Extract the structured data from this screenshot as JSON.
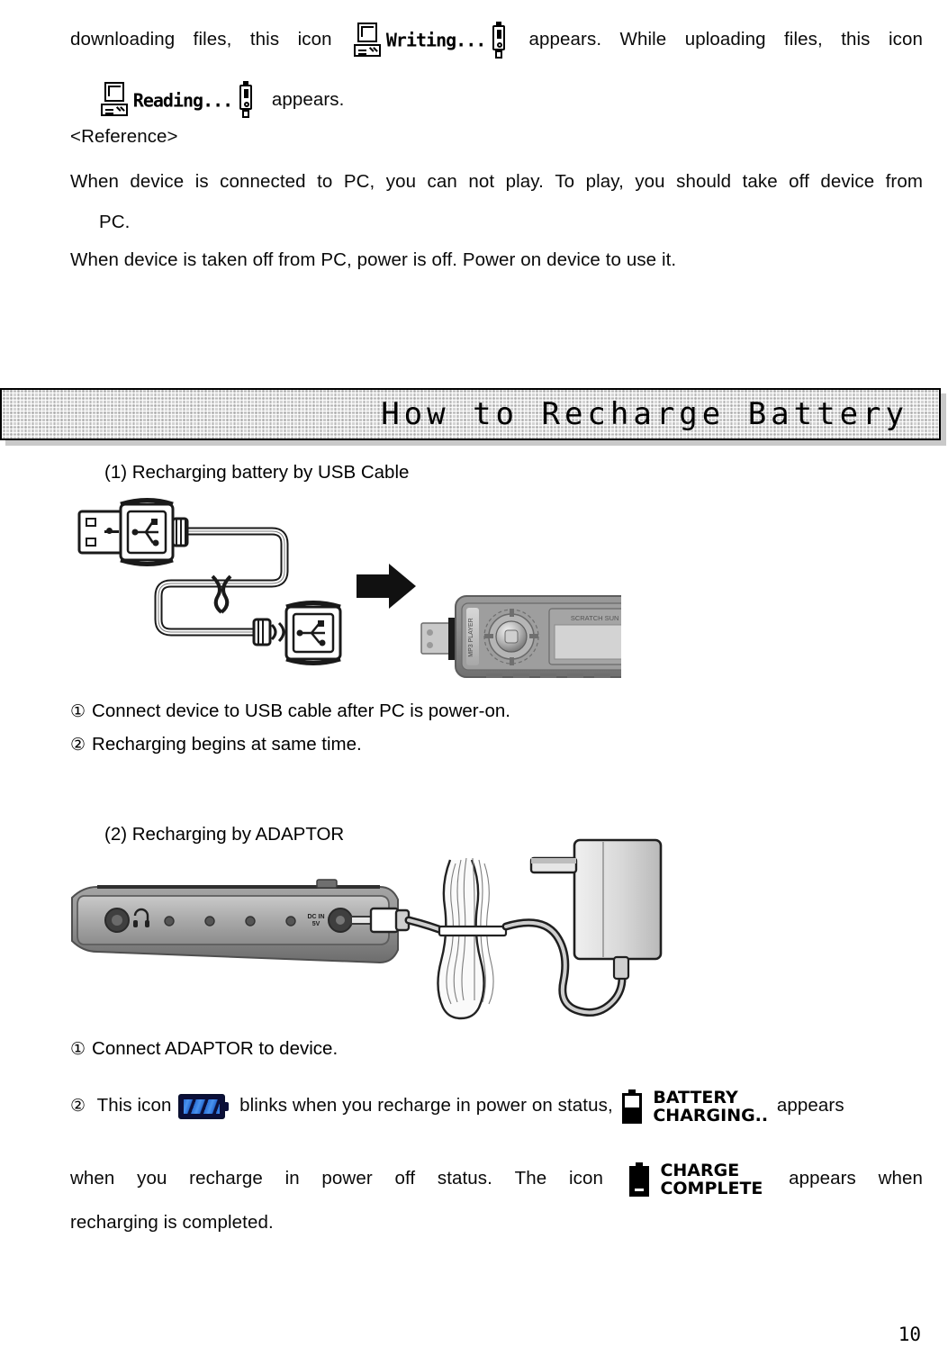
{
  "intro": {
    "line1_words": [
      "downloading",
      "files,",
      "this",
      "icon"
    ],
    "icon_writing_label": "Writing...",
    "line1_after": [
      "appears.",
      "While",
      "uploading",
      "files,",
      "this",
      "icon"
    ],
    "icon_reading_label": "Reading...",
    "line2_after": "appears."
  },
  "reference": {
    "heading": "<Reference>",
    "line1": "When device is connected to PC, you can not play. To play, you should take off device from",
    "line1_words": [
      "When",
      "device",
      "is",
      "connected",
      "to",
      "PC,",
      "you",
      "can",
      "not",
      "play.",
      "To",
      "play,",
      "you",
      "should",
      "take",
      "off",
      "device",
      "from"
    ],
    "line2": "PC.",
    "line3": "When device is taken off from PC, power is off. Power on device to use it."
  },
  "section": {
    "banner_title": "How to Recharge Battery"
  },
  "usb_section": {
    "heading": "(1) Recharging battery by USB Cable",
    "figure_caption": "usb-cable-to-device-diagram",
    "steps": [
      {
        "marker": "①",
        "text": "Connect device to USB cable after PC is power-on."
      },
      {
        "marker": "②",
        "text": "Recharging begins at same time."
      }
    ]
  },
  "adaptor_section": {
    "heading": "(2) Recharging by ADAPTOR",
    "figure_caption": "adaptor-to-device-diagram",
    "step1": {
      "marker": "①",
      "text": "Connect ADAPTOR to device."
    },
    "step2": {
      "marker": "②",
      "pre": "This icon",
      "mid": "blinks when you recharge in power on status,",
      "charging_label_line1": "BATTERY",
      "charging_label_line2": "CHARGING..",
      "post": "appears"
    },
    "final_paragraph_words": [
      "when",
      "you",
      "recharge",
      "in",
      "power",
      "off",
      "status.",
      "The",
      "icon"
    ],
    "complete_label_line1": "CHARGE",
    "complete_label_line2": "COMPLETE",
    "final_after_words": [
      "appears",
      "when"
    ],
    "final_last_line": "recharging is completed."
  },
  "footer": {
    "page_number": "10"
  },
  "device_figure": {
    "usb_port_label": "DC IN 5V",
    "screen_caption": "SCRATCH SUN SET"
  },
  "colors": {
    "banner_bg": "#d4d4d4",
    "banner_border": "#000000",
    "banner_shadow": "#c9c9c9",
    "battery_blue": "#2a6fd6",
    "battery_dark": "#0b0f3a",
    "text": "#0a0a0a",
    "device_body": "#8a8a8a",
    "device_screen": "#cfcfcf"
  }
}
